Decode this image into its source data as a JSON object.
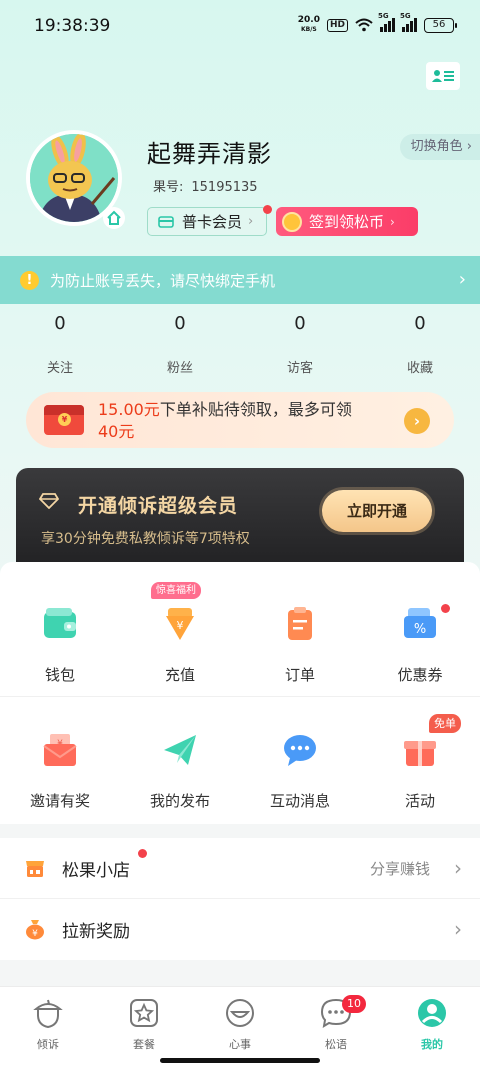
{
  "status_bar": {
    "time": "19:38:39",
    "net_speed": "20.0",
    "net_speed_unit": "KB/S",
    "hd": "HD",
    "signal1_label": "5G",
    "signal2_label": "5G",
    "battery": "56"
  },
  "profile": {
    "username": "起舞弄清影",
    "switch_role": "切换角色",
    "id_label": "果号:",
    "id_value": "15195135",
    "member_label": "普卡会员",
    "checkin_label": "签到领松币"
  },
  "bind_banner": {
    "text": "为防止账号丢失，请尽快绑定手机"
  },
  "stats": [
    {
      "value": "0",
      "label": "关注"
    },
    {
      "value": "0",
      "label": "粉丝"
    },
    {
      "value": "0",
      "label": "访客"
    },
    {
      "value": "0",
      "label": "收藏"
    }
  ],
  "subsidy": {
    "amount": "15.00元",
    "text_mid": "下单补贴待领取，最多可领",
    "max_amount": "40元",
    "yen": "¥"
  },
  "vip": {
    "title": "开通倾诉超级会员",
    "subtitle": "享30分钟免费私教倾诉等7项特权",
    "button": "立即开通"
  },
  "grid_row1": [
    {
      "label": "钱包",
      "icon": "wallet-icon"
    },
    {
      "label": "充值",
      "icon": "recharge-icon",
      "tag": "惊喜福利"
    },
    {
      "label": "订单",
      "icon": "order-icon"
    },
    {
      "label": "优惠券",
      "icon": "coupon-icon"
    }
  ],
  "grid_row2": [
    {
      "label": "邀请有奖",
      "icon": "invite-icon"
    },
    {
      "label": "我的发布",
      "icon": "publish-icon"
    },
    {
      "label": "互动消息",
      "icon": "message-icon"
    },
    {
      "label": "活动",
      "icon": "gift-icon",
      "tag": "免单"
    }
  ],
  "list": [
    {
      "label": "松果小店",
      "aux": "分享赚钱",
      "icon": "shop-icon"
    },
    {
      "label": "拉新奖励",
      "aux": "",
      "icon": "moneybag-icon"
    }
  ],
  "tabbar": [
    {
      "label": "倾诉",
      "icon": "acorn-icon"
    },
    {
      "label": "套餐",
      "icon": "star-box-icon"
    },
    {
      "label": "心事",
      "icon": "smile-icon"
    },
    {
      "label": "松语",
      "icon": "chat-icon",
      "badge": "10"
    },
    {
      "label": "我的",
      "icon": "user-icon",
      "active": true
    }
  ],
  "colors": {
    "accent": "#2bc7a8",
    "banner": "#84dbd0",
    "checkin": "#fb3d68",
    "vip_gold": "#f4d6a4",
    "badge_red": "#f3283e"
  }
}
